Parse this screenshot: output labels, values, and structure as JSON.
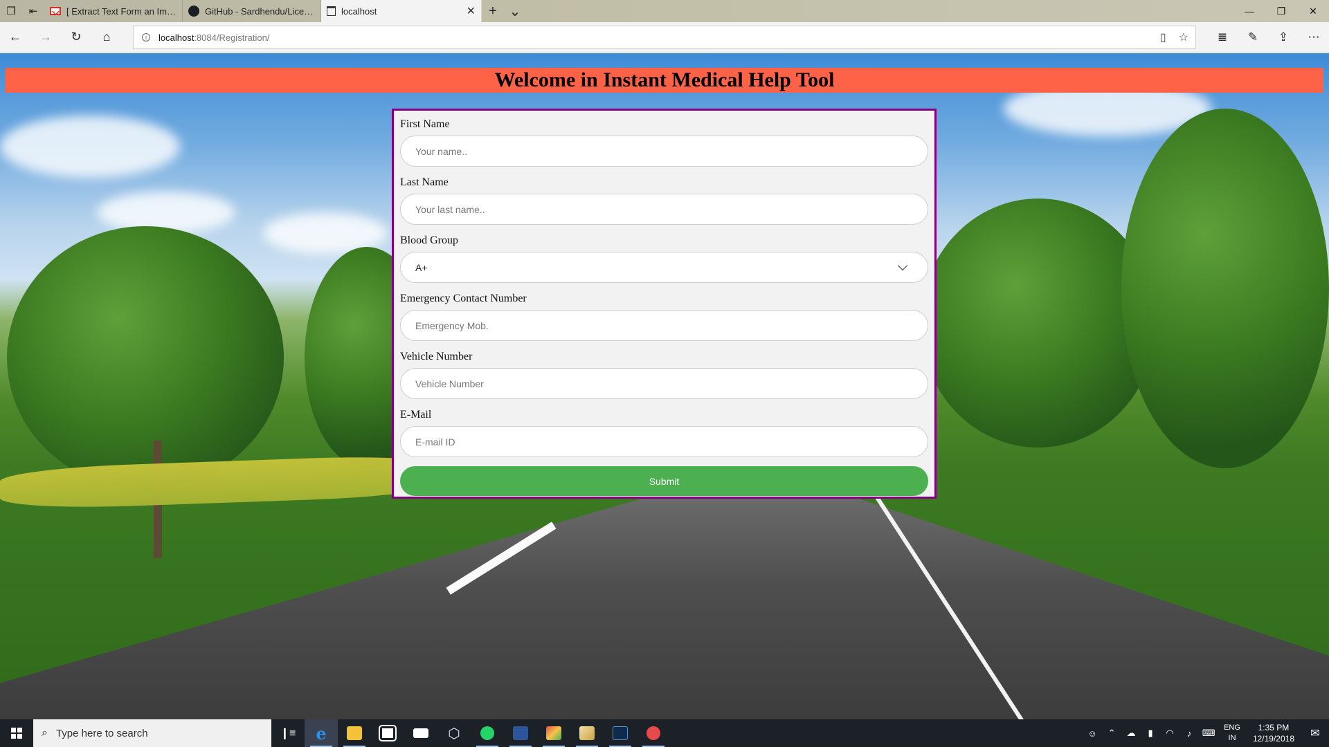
{
  "browser": {
    "tabs": [
      {
        "title": "[ Extract Text Form an Image",
        "icon": "gmail-icon"
      },
      {
        "title": "GitHub - Sardhendu/License",
        "icon": "github-icon"
      },
      {
        "title": "localhost",
        "icon": "page-icon",
        "active": true
      }
    ],
    "address": {
      "host": "localhost",
      "path": ":8084/Registration/"
    }
  },
  "page": {
    "title": "Welcome in Instant Medical Help Tool",
    "header_color": "#ff6347",
    "form_border_color": "#800080",
    "form": {
      "first_name": {
        "label": "First Name",
        "placeholder": "Your name.."
      },
      "last_name": {
        "label": "Last Name",
        "placeholder": "Your last name.."
      },
      "blood_group": {
        "label": "Blood Group",
        "value": "A+"
      },
      "emergency": {
        "label": "Emergency Contact Number",
        "placeholder": "Emergency Mob."
      },
      "vehicle": {
        "label": "Vehicle Number",
        "placeholder": "Vehicle Number"
      },
      "email": {
        "label": "E-Mail",
        "placeholder": "E-mail ID"
      },
      "submit_label": "Submit",
      "submit_color": "#4caf50"
    }
  },
  "taskbar": {
    "search_placeholder": "Type here to search",
    "lang_top": "ENG",
    "lang_bottom": "IN",
    "time": "1:35 PM",
    "date": "12/19/2018"
  }
}
